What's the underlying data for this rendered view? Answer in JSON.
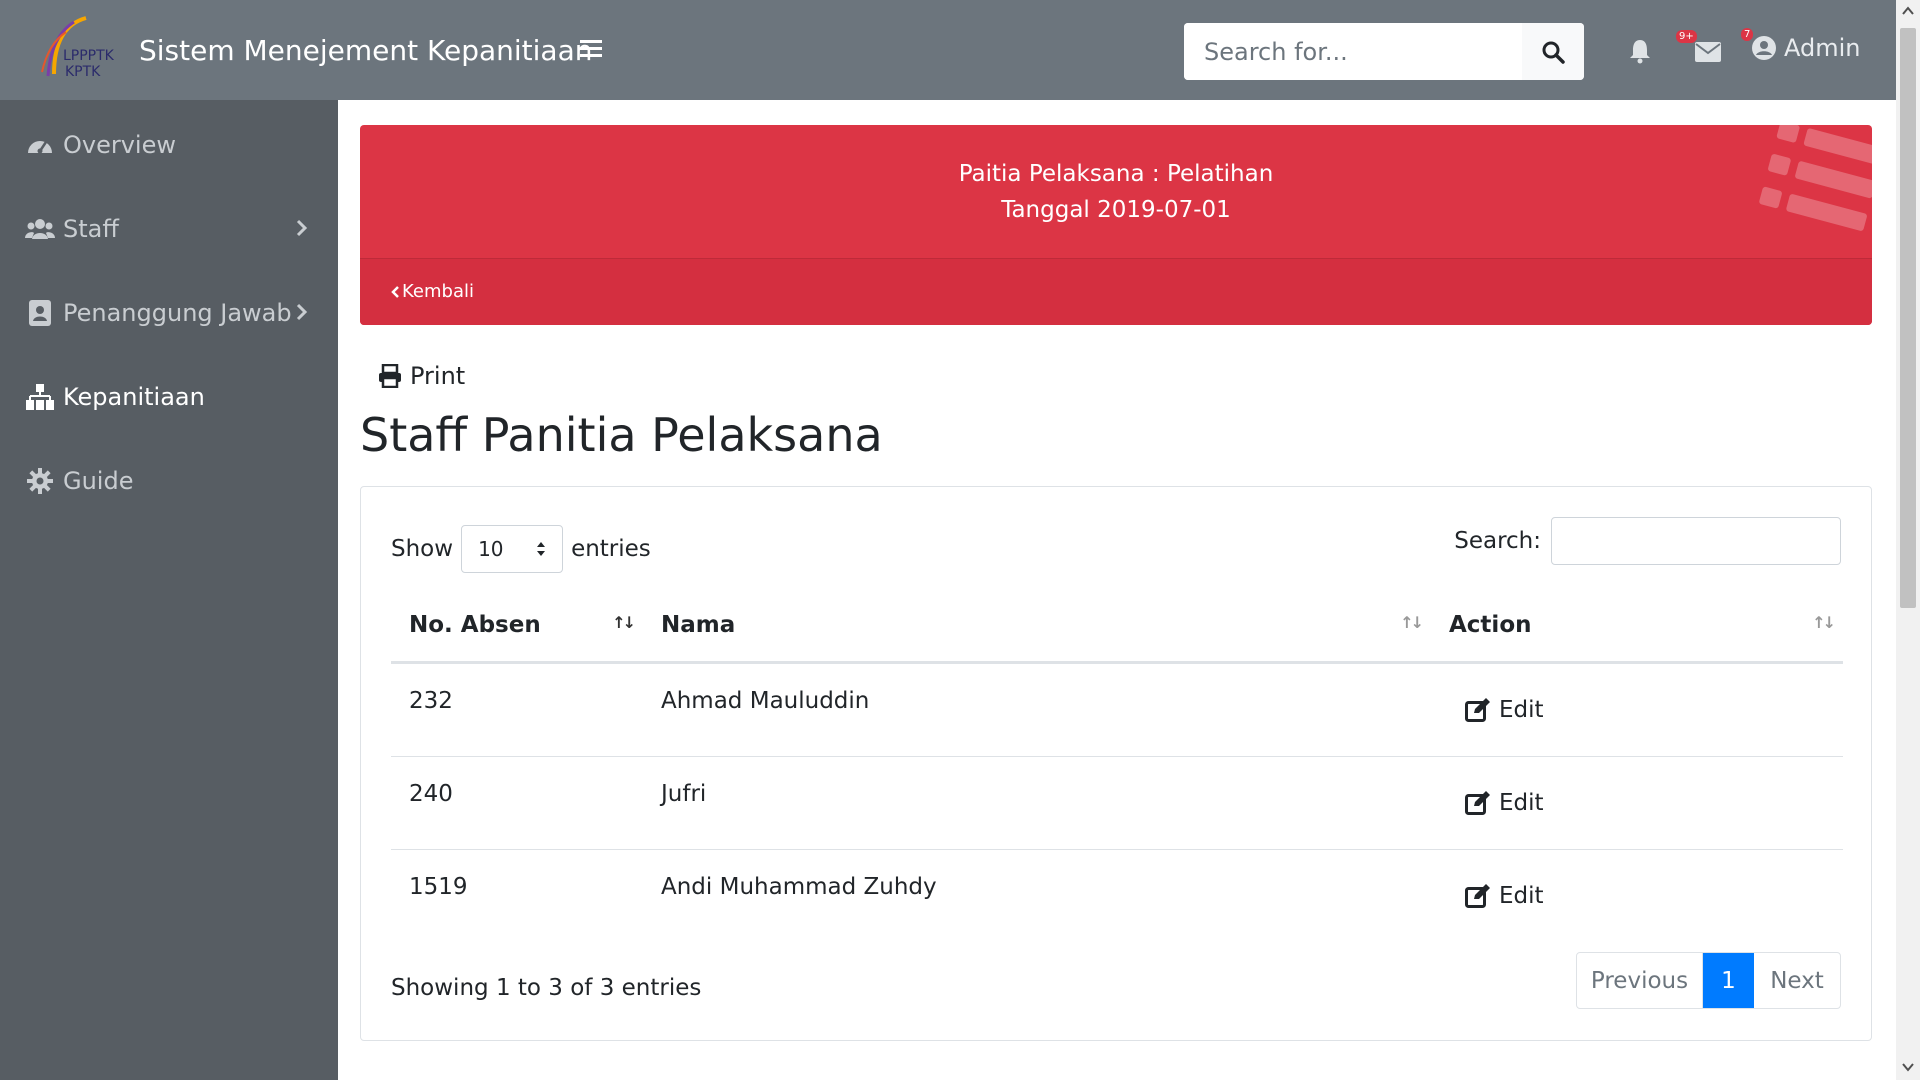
{
  "header": {
    "logo_text_line1": "LPPPTK",
    "logo_text_line2": "KPTK",
    "app_title": "Sistem Menejement Kepanitiaan",
    "search_placeholder": "Search for...",
    "alerts_badge": "9+",
    "messages_badge": "7",
    "user_name": "Admin"
  },
  "sidebar": {
    "items": [
      {
        "label": "Overview",
        "icon": "tachometer-icon"
      },
      {
        "label": "Staff",
        "icon": "users-icon"
      },
      {
        "label": "Penanggung Jawab",
        "icon": "id-badge-icon"
      },
      {
        "label": "Kepanitiaan",
        "icon": "sitemap-icon"
      },
      {
        "label": "Guide",
        "icon": "gear-icon"
      }
    ]
  },
  "banner": {
    "line1": "Paitia Pelaksana : Pelatihan",
    "line2": "Tanggal 2019-07-01",
    "back_label": "Kembali"
  },
  "main": {
    "print_label": "Print",
    "heading": "Staff Panitia Pelaksana"
  },
  "table": {
    "show_label": "Show",
    "page_length": "10",
    "entries_label": "entries",
    "search_label": "Search:",
    "columns": [
      "No. Absen",
      "Nama",
      "Action"
    ],
    "rows": [
      {
        "no": "232",
        "nama": "Ahmad Mauluddin",
        "action": "Edit"
      },
      {
        "no": "240",
        "nama": "Jufri",
        "action": "Edit"
      },
      {
        "no": "1519",
        "nama": "Andi Muhammad Zuhdy",
        "action": "Edit"
      }
    ],
    "info": "Showing 1 to 3 of 3 entries",
    "pagination": {
      "previous": "Previous",
      "current": "1",
      "next": "Next"
    }
  },
  "colors": {
    "topbar": "#6c757d",
    "sidebar": "#575d63",
    "banner": "#dc3545",
    "primary": "#007bff"
  }
}
